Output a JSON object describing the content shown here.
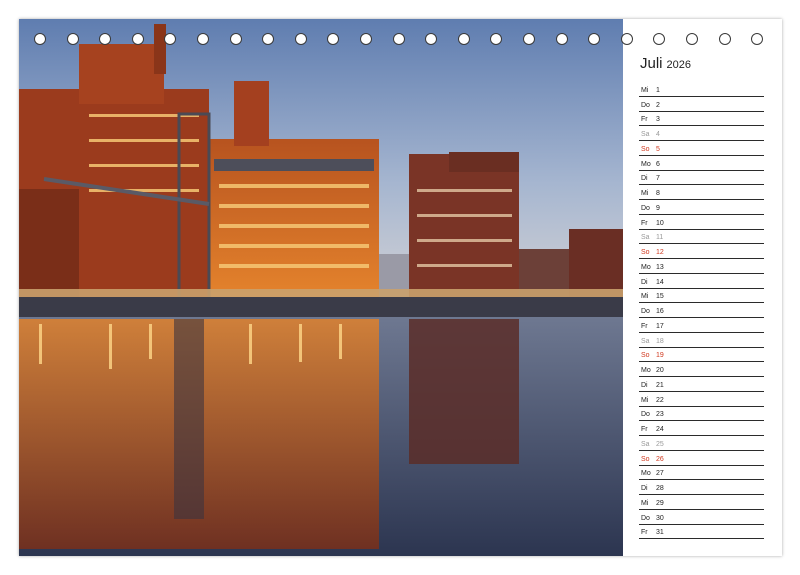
{
  "calendar": {
    "month": "Juli",
    "year": "2026",
    "days": [
      {
        "wd": "Mi",
        "d": "1",
        "type": "weekday"
      },
      {
        "wd": "Do",
        "d": "2",
        "type": "weekday"
      },
      {
        "wd": "Fr",
        "d": "3",
        "type": "weekday"
      },
      {
        "wd": "Sa",
        "d": "4",
        "type": "sat"
      },
      {
        "wd": "So",
        "d": "5",
        "type": "sun"
      },
      {
        "wd": "Mo",
        "d": "6",
        "type": "weekday"
      },
      {
        "wd": "Di",
        "d": "7",
        "type": "weekday"
      },
      {
        "wd": "Mi",
        "d": "8",
        "type": "weekday"
      },
      {
        "wd": "Do",
        "d": "9",
        "type": "weekday"
      },
      {
        "wd": "Fr",
        "d": "10",
        "type": "weekday"
      },
      {
        "wd": "Sa",
        "d": "11",
        "type": "sat"
      },
      {
        "wd": "So",
        "d": "12",
        "type": "sun"
      },
      {
        "wd": "Mo",
        "d": "13",
        "type": "weekday"
      },
      {
        "wd": "Di",
        "d": "14",
        "type": "weekday"
      },
      {
        "wd": "Mi",
        "d": "15",
        "type": "weekday"
      },
      {
        "wd": "Do",
        "d": "16",
        "type": "weekday"
      },
      {
        "wd": "Fr",
        "d": "17",
        "type": "weekday"
      },
      {
        "wd": "Sa",
        "d": "18",
        "type": "sat"
      },
      {
        "wd": "So",
        "d": "19",
        "type": "sun"
      },
      {
        "wd": "Mo",
        "d": "20",
        "type": "weekday"
      },
      {
        "wd": "Di",
        "d": "21",
        "type": "weekday"
      },
      {
        "wd": "Mi",
        "d": "22",
        "type": "weekday"
      },
      {
        "wd": "Do",
        "d": "23",
        "type": "weekday"
      },
      {
        "wd": "Fr",
        "d": "24",
        "type": "weekday"
      },
      {
        "wd": "Sa",
        "d": "25",
        "type": "sat"
      },
      {
        "wd": "So",
        "d": "26",
        "type": "sun"
      },
      {
        "wd": "Mo",
        "d": "27",
        "type": "weekday"
      },
      {
        "wd": "Di",
        "d": "28",
        "type": "weekday"
      },
      {
        "wd": "Mi",
        "d": "29",
        "type": "weekday"
      },
      {
        "wd": "Do",
        "d": "30",
        "type": "weekday"
      },
      {
        "wd": "Fr",
        "d": "31",
        "type": "weekday"
      }
    ]
  },
  "binding": {
    "ring_count": 23
  },
  "colors": {
    "sunday": "#d0391f",
    "saturday": "#9a9a9a",
    "text": "#222222"
  }
}
